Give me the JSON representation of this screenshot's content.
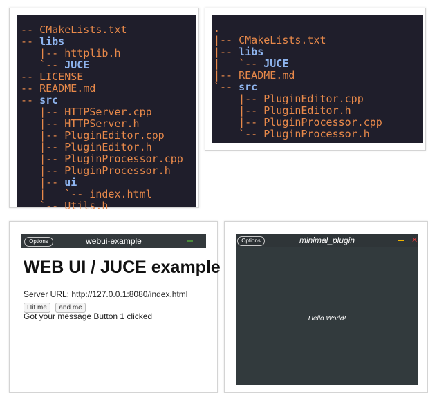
{
  "tree_full": {
    "lines": [
      {
        "prefix": "-- ",
        "name": "CMakeLists.txt",
        "kind": "file"
      },
      {
        "prefix": "-- ",
        "name": "libs",
        "kind": "dir"
      },
      {
        "prefix": "   |-- ",
        "name": "httplib.h",
        "kind": "file"
      },
      {
        "prefix": "   `-- ",
        "name": "JUCE",
        "kind": "dir"
      },
      {
        "prefix": "-- ",
        "name": "LICENSE",
        "kind": "file"
      },
      {
        "prefix": "-- ",
        "name": "README.md",
        "kind": "file"
      },
      {
        "prefix": "-- ",
        "name": "src",
        "kind": "dir"
      },
      {
        "prefix": "   |-- ",
        "name": "HTTPServer.cpp",
        "kind": "file"
      },
      {
        "prefix": "   |-- ",
        "name": "HTTPServer.h",
        "kind": "file"
      },
      {
        "prefix": "   |-- ",
        "name": "PluginEditor.cpp",
        "kind": "file"
      },
      {
        "prefix": "   |-- ",
        "name": "PluginEditor.h",
        "kind": "file"
      },
      {
        "prefix": "   |-- ",
        "name": "PluginProcessor.cpp",
        "kind": "file"
      },
      {
        "prefix": "   |-- ",
        "name": "PluginProcessor.h",
        "kind": "file"
      },
      {
        "prefix": "   |-- ",
        "name": "ui",
        "kind": "dir"
      },
      {
        "prefix": "   |   `-- ",
        "name": "index.html",
        "kind": "file"
      },
      {
        "prefix": "   `-- ",
        "name": "Utils.h",
        "kind": "file"
      }
    ]
  },
  "tree_min": {
    "lines": [
      {
        "prefix": ".",
        "name": "",
        "kind": "dir"
      },
      {
        "prefix": "|-- ",
        "name": "CMakeLists.txt",
        "kind": "file"
      },
      {
        "prefix": "|-- ",
        "name": "libs",
        "kind": "dir"
      },
      {
        "prefix": "|   `-- ",
        "name": "JUCE",
        "kind": "dir"
      },
      {
        "prefix": "|-- ",
        "name": "README.md",
        "kind": "file"
      },
      {
        "prefix": "`-- ",
        "name": "src",
        "kind": "dir"
      },
      {
        "prefix": "    |-- ",
        "name": "PluginEditor.cpp",
        "kind": "file"
      },
      {
        "prefix": "    |-- ",
        "name": "PluginEditor.h",
        "kind": "file"
      },
      {
        "prefix": "    |-- ",
        "name": "PluginProcessor.cpp",
        "kind": "file"
      },
      {
        "prefix": "    `-- ",
        "name": "PluginProcessor.h",
        "kind": "file"
      }
    ]
  },
  "webui": {
    "options_label": "Options",
    "title": "webui-example",
    "heading": "WEB UI / JUCE example",
    "server_url": "Server URL: http://127.0.0.1:8080/index.html",
    "button1_label": "Hit me",
    "button2_label": "and me",
    "message": "Got your message Button 1 clicked"
  },
  "minimal": {
    "options_label": "Options",
    "title": "minimal_plugin",
    "close_glyph": "✕",
    "body_text": "Hello World!"
  },
  "colors": {
    "terminal_bg": "#1f1e2b",
    "tree_orange": "#e8894a",
    "dir_blue": "#8fb5ef",
    "titlebar": "#33393c",
    "plugin_body": "#323a3d",
    "minimize_yellow": "#f0b400",
    "close_red": "#e03b3b"
  }
}
